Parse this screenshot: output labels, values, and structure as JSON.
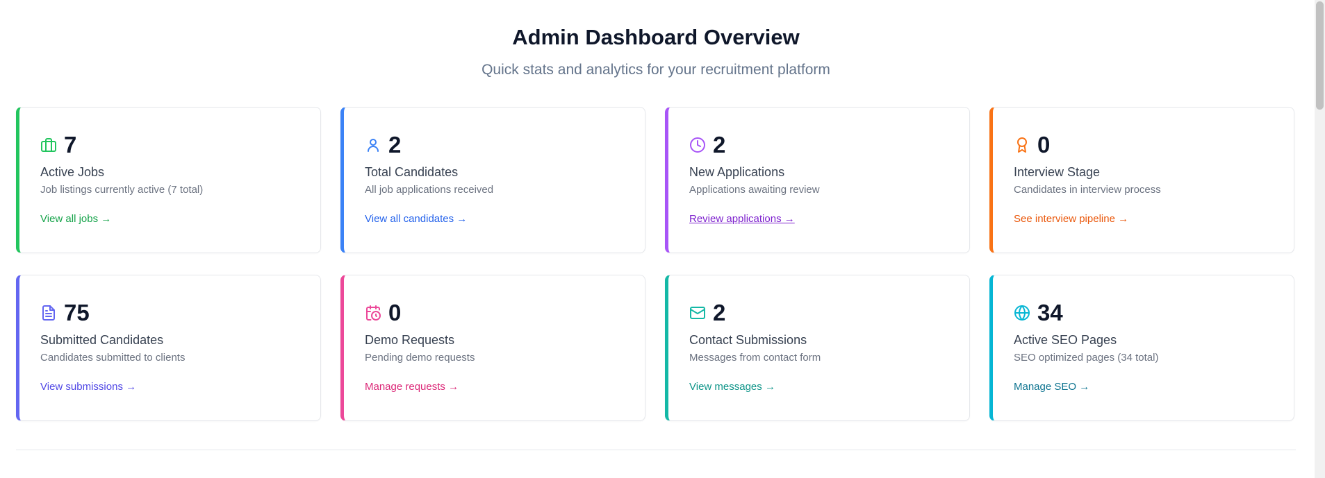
{
  "header": {
    "title": "Admin Dashboard Overview",
    "subtitle": "Quick stats and analytics for your recruitment platform"
  },
  "cards": [
    {
      "value": "7",
      "label": "Active Jobs",
      "description": "Job listings currently active (7 total)",
      "link": "View all jobs →",
      "icon": "briefcase-icon",
      "accent": "#22c55e",
      "link_color": "#16a34a"
    },
    {
      "value": "2",
      "label": "Total Candidates",
      "description": "All job applications received",
      "link": "View all candidates →",
      "icon": "user-icon",
      "accent": "#3b82f6",
      "link_color": "#2563eb"
    },
    {
      "value": "2",
      "label": "New Applications",
      "description": "Applications awaiting review",
      "link": "Review applications →",
      "icon": "clock-icon",
      "accent": "#a855f7",
      "link_color": "#7e22ce"
    },
    {
      "value": "0",
      "label": "Interview Stage",
      "description": "Candidates in interview process",
      "link": "See interview pipeline →",
      "icon": "award-icon",
      "accent": "#f97316",
      "link_color": "#ea580c"
    },
    {
      "value": "75",
      "label": "Submitted Candidates",
      "description": "Candidates submitted to clients",
      "link": "View submissions →",
      "icon": "file-text-icon",
      "accent": "#6366f1",
      "link_color": "#4f46e5"
    },
    {
      "value": "0",
      "label": "Demo Requests",
      "description": "Pending demo requests",
      "link": "Manage requests →",
      "icon": "calendar-clock-icon",
      "accent": "#ec4899",
      "link_color": "#db2777"
    },
    {
      "value": "2",
      "label": "Contact Submissions",
      "description": "Messages from contact form",
      "link": "View messages →",
      "icon": "mail-icon",
      "accent": "#14b8a6",
      "link_color": "#0d9488"
    },
    {
      "value": "34",
      "label": "Active SEO Pages",
      "description": "SEO optimized pages (34 total)",
      "link": "Manage SEO →",
      "icon": "globe-icon",
      "accent": "#06b6d4",
      "link_color": "#0e7490"
    }
  ]
}
